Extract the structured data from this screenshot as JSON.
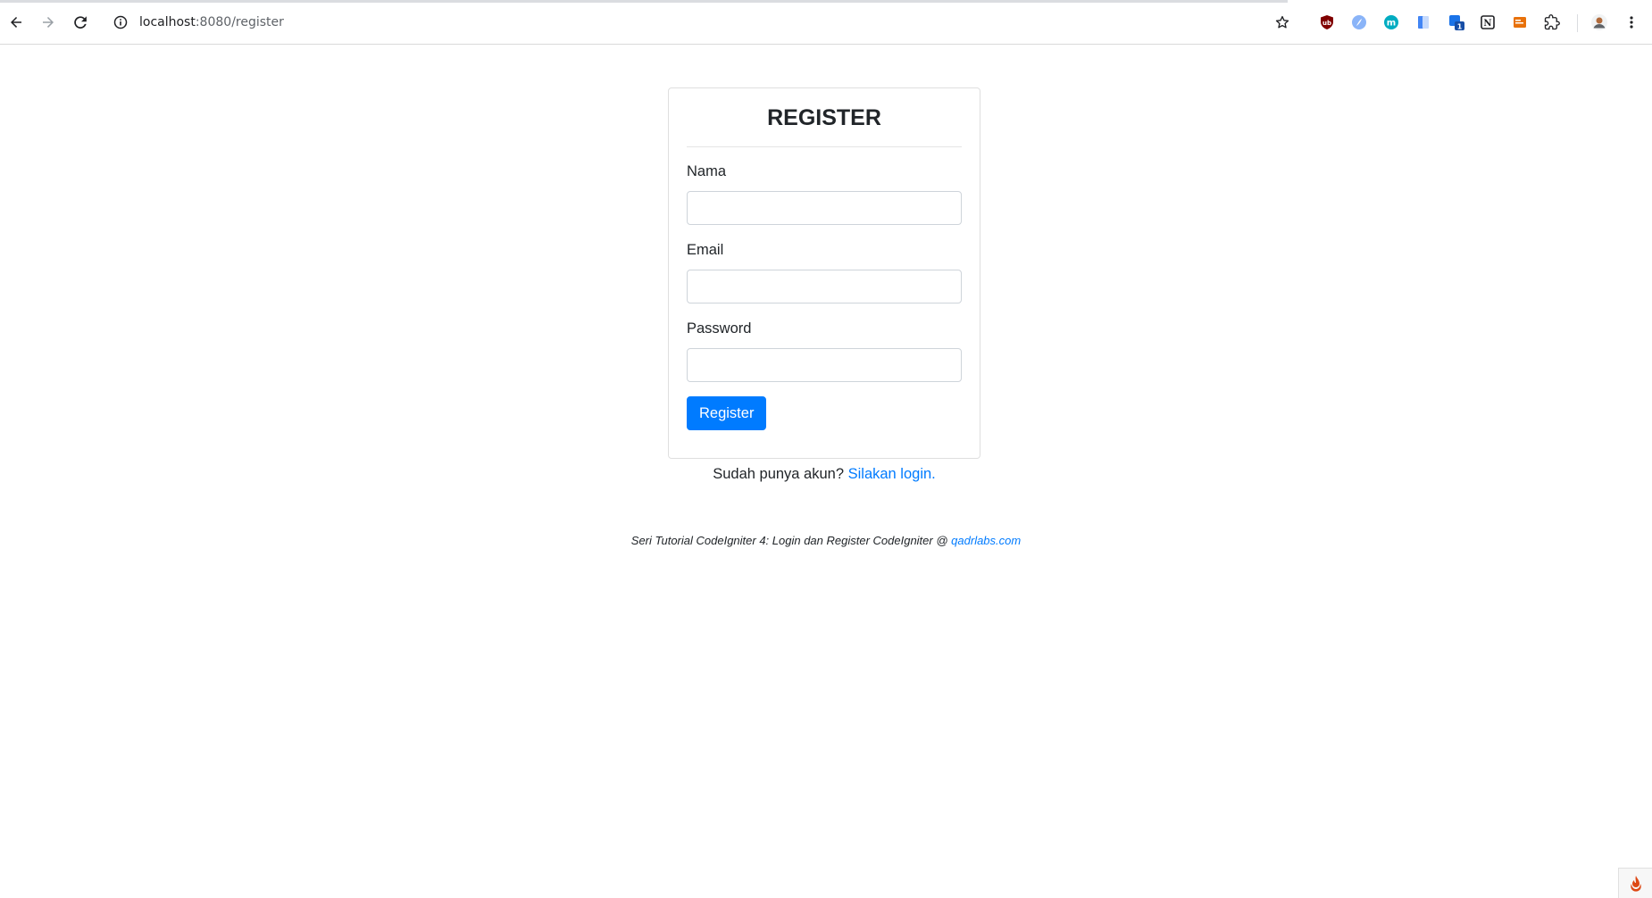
{
  "browser": {
    "url_host": "localhost",
    "url_path": ":8080/register",
    "extensions": [
      {
        "name": "ublock-icon",
        "color": "#800000"
      },
      {
        "name": "feather-extension-icon",
        "color": "#8ab4f8"
      },
      {
        "name": "m-extension-icon",
        "color": "#00acc1"
      },
      {
        "name": "translate-extension-icon",
        "color": "#4285f4"
      },
      {
        "name": "badge-extension-icon",
        "color": "#1a73e8",
        "badge": "1"
      },
      {
        "name": "notion-icon",
        "color": "#202124"
      },
      {
        "name": "orange-extension-icon",
        "color": "#e8710a"
      },
      {
        "name": "puzzle-icon",
        "color": "#202124"
      }
    ]
  },
  "register": {
    "title": "REGISTER",
    "fields": {
      "name": {
        "label": "Nama",
        "value": "",
        "placeholder": ""
      },
      "email": {
        "label": "Email",
        "value": "",
        "placeholder": ""
      },
      "password": {
        "label": "Password",
        "value": "",
        "placeholder": ""
      }
    },
    "submit_label": "Register",
    "login_prompt": "Sudah punya akun?",
    "login_link": "Silakan login.",
    "footer_text": "Seri Tutorial CodeIgniter 4: Login dan Register CodeIgniter @",
    "footer_link": "qadrlabs.com"
  },
  "colors": {
    "primary": "#007bff",
    "text": "#212529"
  }
}
